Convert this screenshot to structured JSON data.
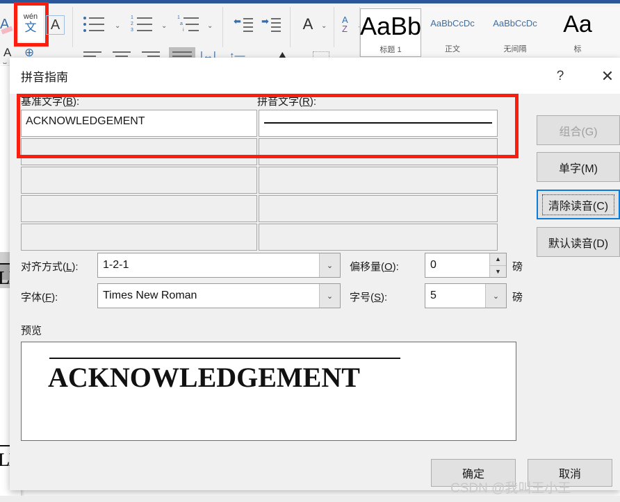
{
  "ribbon": {
    "pinyin_button": {
      "top_label": "wén",
      "bottom_label": "文",
      "name": "拼音指南"
    },
    "styles": [
      {
        "preview": "AaBb",
        "name": "标题 1"
      },
      {
        "preview": "AaBbCcDc",
        "name": "正文"
      },
      {
        "preview": "AaBbCcDc",
        "name": "无间隔"
      },
      {
        "preview": "Aa",
        "name": "标"
      }
    ]
  },
  "document": {
    "visible_fragment": "LE"
  },
  "dialog": {
    "title": "拼音指南",
    "help_glyph": "?",
    "close_glyph": "✕",
    "columns": {
      "base_label": "基准文字(B):",
      "base_accesskey": "B",
      "ruby_label": "拼音文字(R):",
      "ruby_accesskey": "R"
    },
    "rows": [
      {
        "base": "ACKNOWLEDGEMENT",
        "ruby": "",
        "active": true
      },
      {
        "base": "",
        "ruby": "",
        "active": false
      },
      {
        "base": "",
        "ruby": "",
        "active": false
      },
      {
        "base": "",
        "ruby": "",
        "active": false
      },
      {
        "base": "",
        "ruby": "",
        "active": false
      }
    ],
    "side_buttons": [
      {
        "label": "组合(G)",
        "disabled": true,
        "focused": false
      },
      {
        "label": "单字(M)",
        "disabled": false,
        "focused": false
      },
      {
        "label": "清除读音(C)",
        "disabled": false,
        "focused": true
      },
      {
        "label": "默认读音(D)",
        "disabled": false,
        "focused": false
      }
    ],
    "fields": {
      "alignment": {
        "label": "对齐方式(L):",
        "value": "1-2-1"
      },
      "offset": {
        "label": "偏移量(O):",
        "value": "0",
        "unit": "磅"
      },
      "font": {
        "label": "字体(F):",
        "value": "Times New Roman"
      },
      "size": {
        "label": "字号(S):",
        "value": "5",
        "unit": "磅"
      }
    },
    "preview": {
      "label": "预览",
      "text": "ACKNOWLEDGEMENT"
    },
    "footer": {
      "ok": "确定",
      "cancel": "取消"
    }
  },
  "annotations": {
    "highlight_color": "#fb1e0e",
    "focus_color": "#0a7bd6"
  },
  "watermark": "CSDN @我叫王小王"
}
